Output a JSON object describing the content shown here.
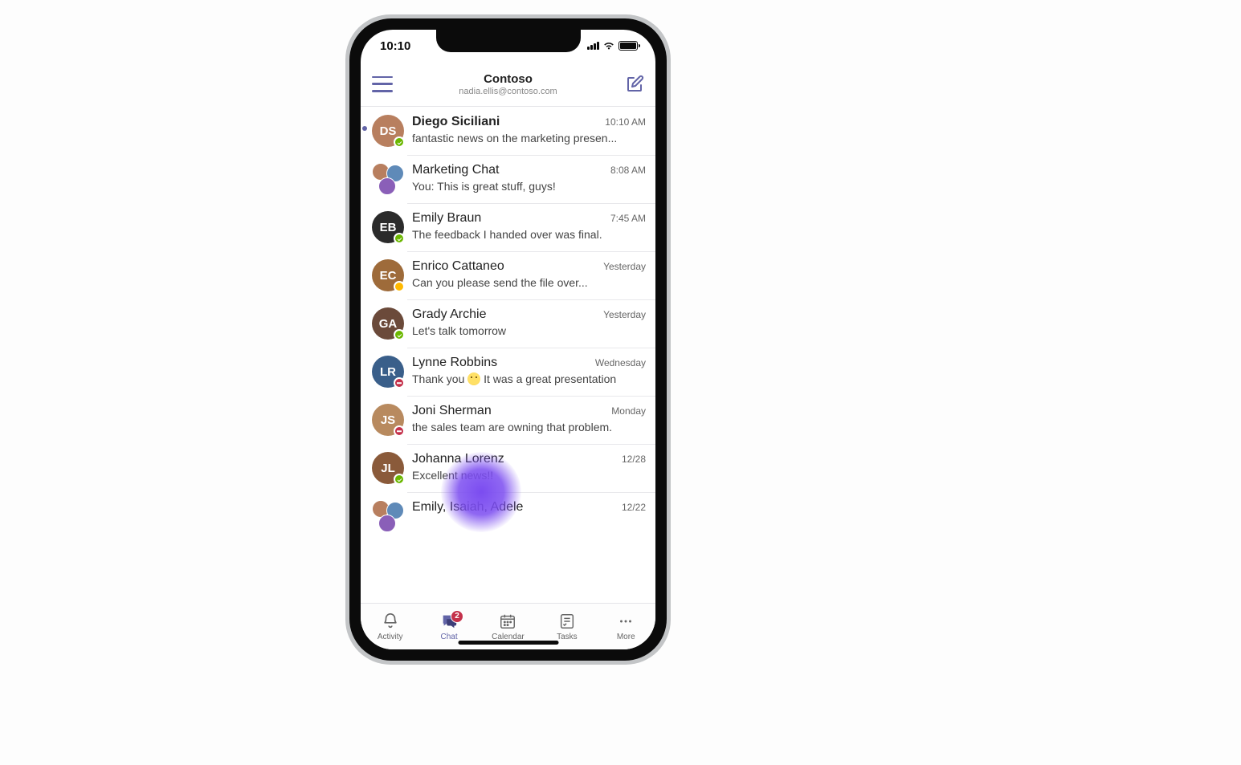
{
  "status": {
    "time": "10:10"
  },
  "header": {
    "org": "Contoso",
    "email": "nadia.ellis@contoso.com"
  },
  "chats": [
    {
      "name": "Diego Siciliani",
      "preview": "fantastic news on the marketing presen...",
      "time": "10:10 AM",
      "unread": true,
      "presence": "avail",
      "avatarColor": "#b87f5f"
    },
    {
      "name": "Marketing Chat",
      "preview": "You: This is great stuff, guys!",
      "time": "8:08 AM",
      "unread": false,
      "group": true
    },
    {
      "name": "Emily Braun",
      "preview": "The feedback I handed over was final.",
      "time": "7:45 AM",
      "unread": false,
      "presence": "avail",
      "avatarColor": "#2b2b2b"
    },
    {
      "name": "Enrico Cattaneo",
      "preview": "Can you please send the file over...",
      "time": "Yesterday",
      "unread": false,
      "presence": "away",
      "avatarColor": "#9e6b3a"
    },
    {
      "name": "Grady Archie",
      "preview": "Let's talk tomorrow",
      "time": "Yesterday",
      "unread": false,
      "presence": "avail",
      "avatarColor": "#6b4a3a"
    },
    {
      "name": "Lynne Robbins",
      "previewPrefix": "Thank you ",
      "previewSuffix": " It was a great presentation",
      "emoji": true,
      "time": "Wednesday",
      "unread": false,
      "presence": "busy",
      "avatarColor": "#3a5f8a"
    },
    {
      "name": "Joni Sherman",
      "preview": "the sales team are owning that problem.",
      "time": "Monday",
      "unread": false,
      "presence": "busy",
      "avatarColor": "#b88a5f"
    },
    {
      "name": "Johanna Lorenz",
      "preview": "Excellent news!!",
      "time": "12/28",
      "unread": false,
      "presence": "avail",
      "avatarColor": "#8a5a3a"
    },
    {
      "name": "Emily, Isaiah, Adele",
      "preview": "",
      "time": "12/22",
      "unread": false,
      "group": true
    }
  ],
  "tabs": {
    "activity": "Activity",
    "chat": "Chat",
    "calendar": "Calendar",
    "tasks": "Tasks",
    "more": "More",
    "chat_badge": "2"
  }
}
